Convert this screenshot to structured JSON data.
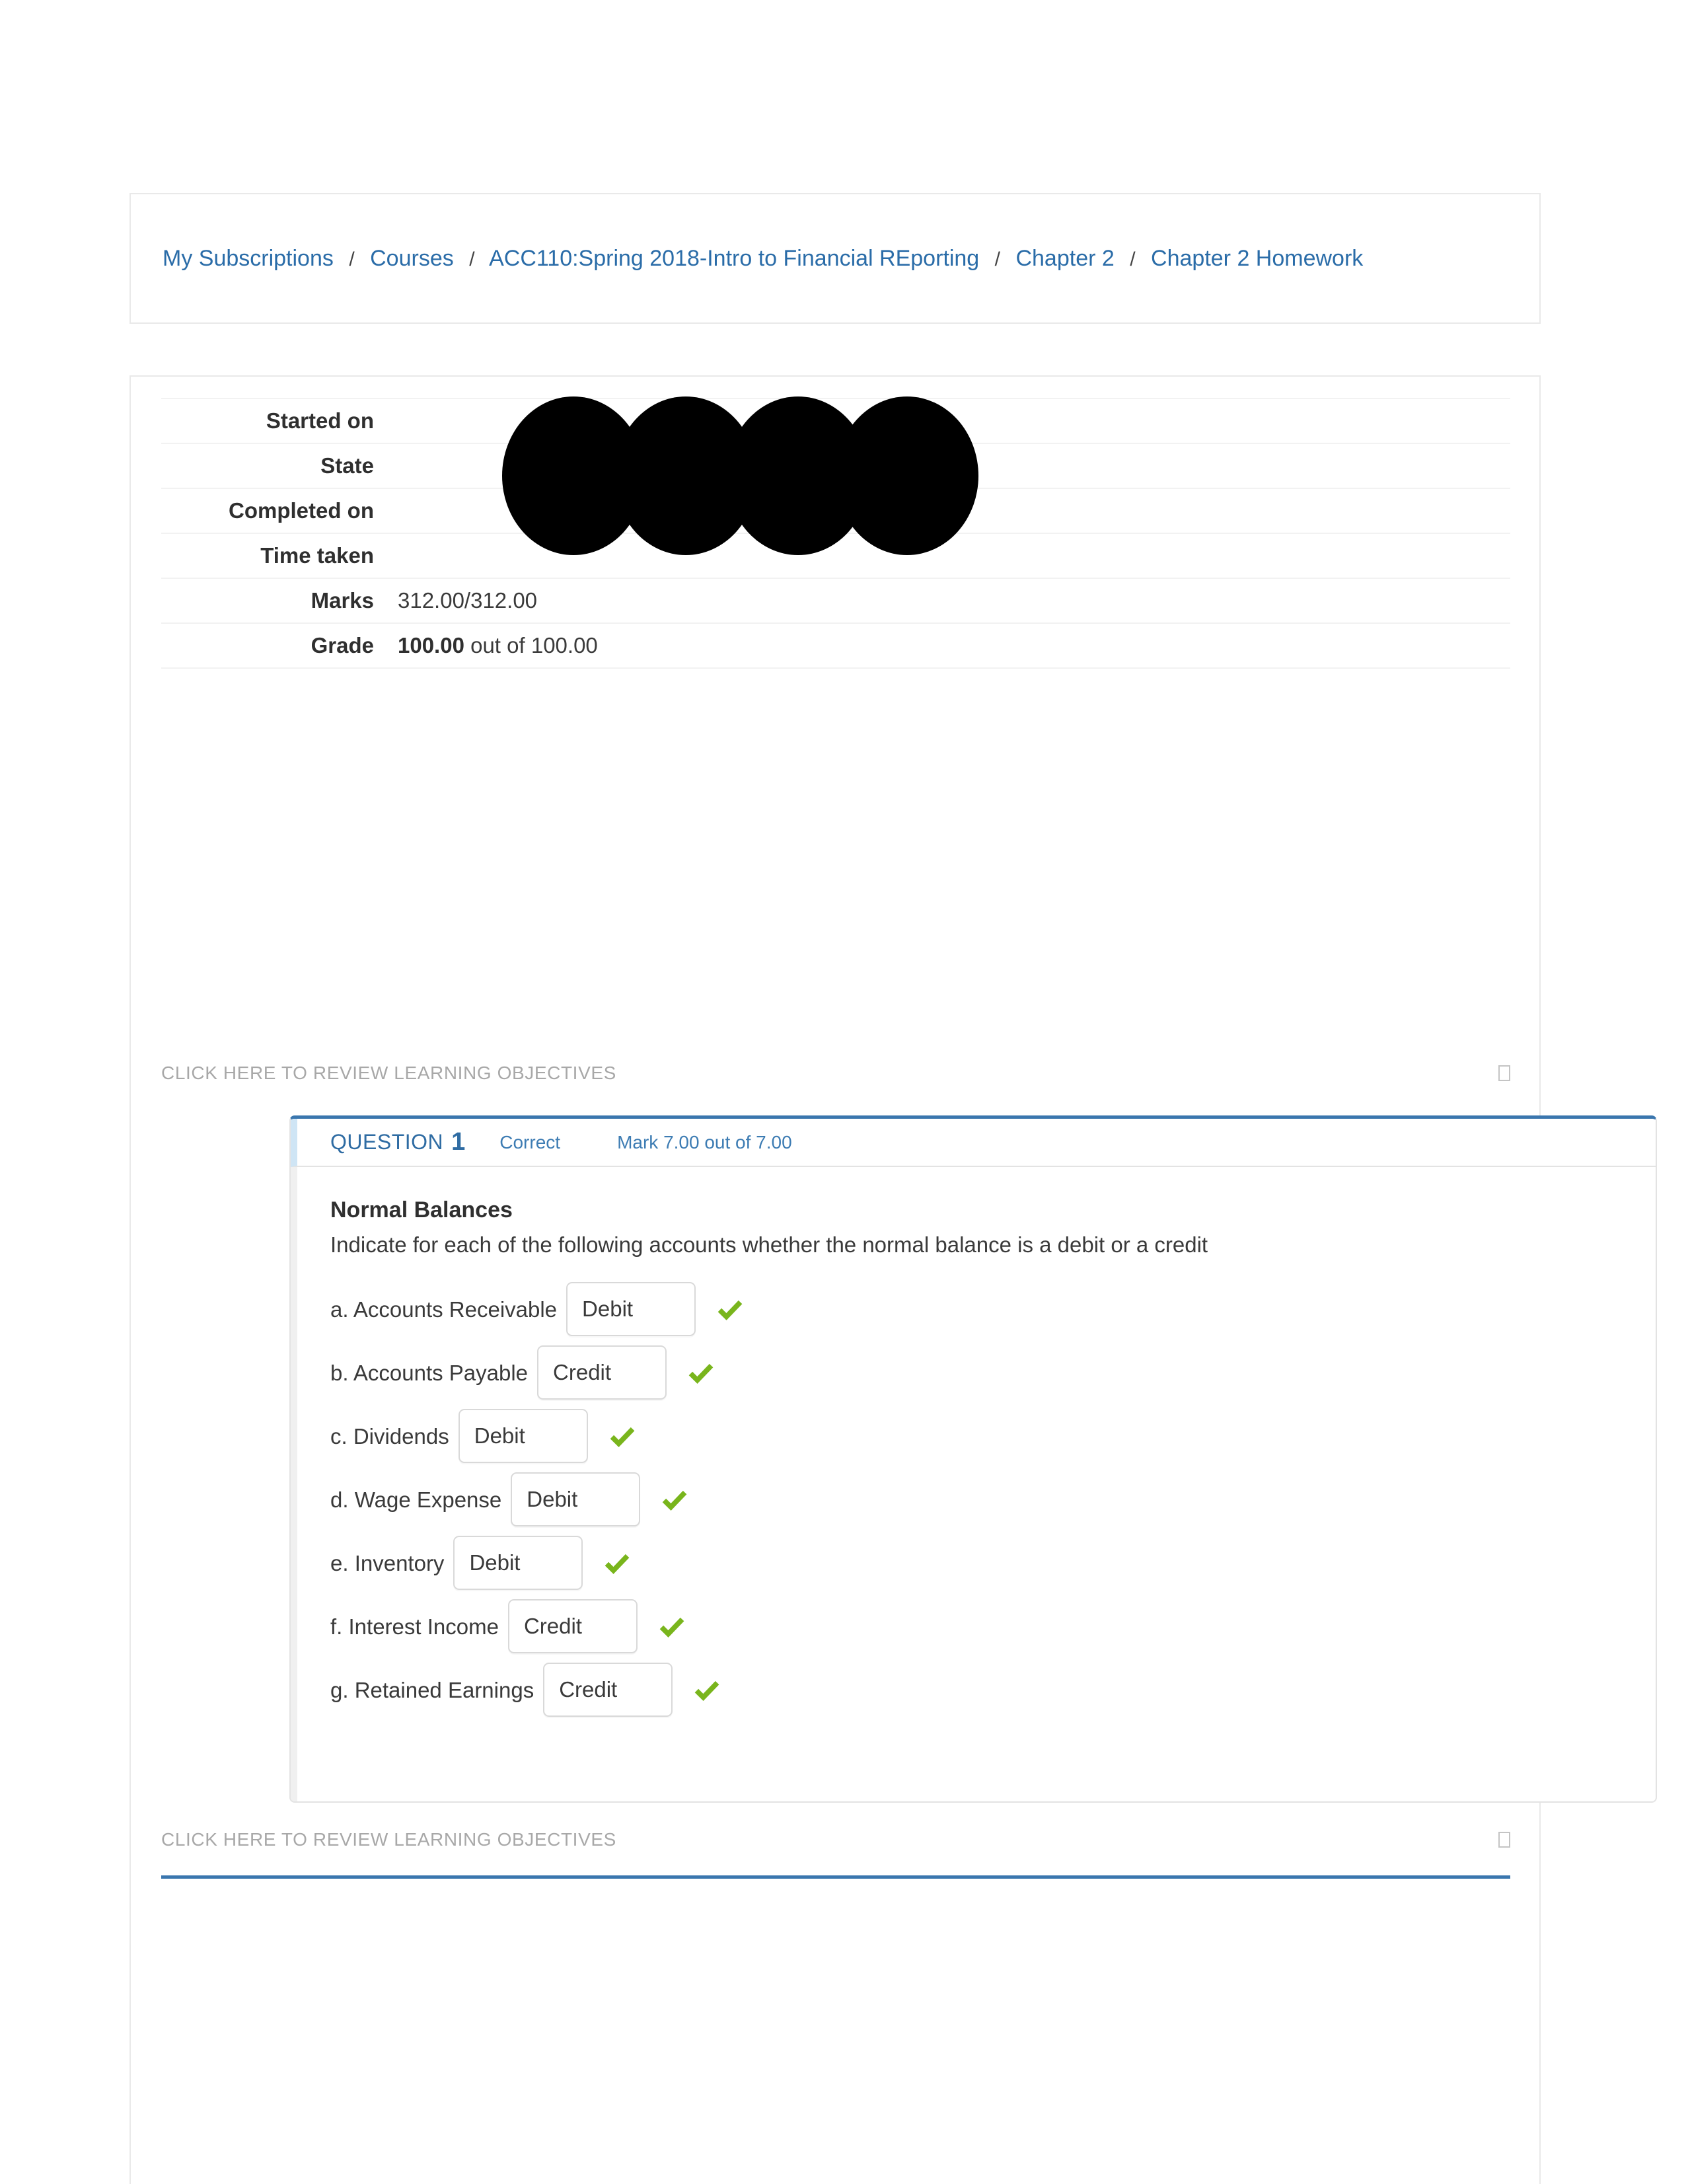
{
  "breadcrumb": {
    "separator": "/",
    "items": [
      {
        "label": "My Subscriptions"
      },
      {
        "label": "Courses"
      },
      {
        "label": "ACC110:Spring 2018-Intro to Financial REporting"
      },
      {
        "label": "Chapter 2"
      },
      {
        "label": "Chapter 2 Homework"
      }
    ]
  },
  "summary": {
    "rows": [
      {
        "label": "Started on",
        "value": "",
        "bold_value": "",
        "redacted": true
      },
      {
        "label": "State",
        "value": "",
        "bold_value": "",
        "redacted": true
      },
      {
        "label": "Completed on",
        "value": "",
        "bold_value": "",
        "redacted": true
      },
      {
        "label": "Time taken",
        "value": "",
        "bold_value": "",
        "redacted": true
      },
      {
        "label": "Marks",
        "value": "312.00/312.00",
        "bold_value": "",
        "redacted": false
      },
      {
        "label": "Grade",
        "value": " out of 100.00",
        "bold_value": "100.00",
        "redacted": false
      }
    ]
  },
  "learning_objectives": {
    "top_label": "CLICK HERE TO REVIEW LEARNING OBJECTIVES",
    "bottom_label": "CLICK HERE TO REVIEW LEARNING OBJECTIVES",
    "toggle_icon": "empty-box-icon"
  },
  "question": {
    "label": "QUESTION",
    "number": "1",
    "state": "Correct",
    "mark": "Mark 7.00 out of 7.00",
    "title": "Normal Balances",
    "prompt": "Indicate for each of the following accounts whether the normal balance is a debit or a credit",
    "answers": [
      {
        "label": "a. Accounts Receivable",
        "value": "Debit",
        "result_icon": "check-icon"
      },
      {
        "label": "b. Accounts Payable",
        "value": "Credit",
        "result_icon": "check-icon"
      },
      {
        "label": "c. Dividends",
        "value": "Debit",
        "result_icon": "check-icon"
      },
      {
        "label": "d. Wage Expense",
        "value": "Debit",
        "result_icon": "check-icon"
      },
      {
        "label": "e. Inventory",
        "value": "Debit",
        "result_icon": "check-icon"
      },
      {
        "label": "f. Interest Income",
        "value": "Credit",
        "result_icon": "check-icon"
      },
      {
        "label": "g. Retained Earnings",
        "value": "Credit",
        "result_icon": "check-icon"
      }
    ]
  },
  "colors": {
    "link_blue": "#2a6ca8",
    "accent_blue": "#3a76ae",
    "question_blue": "#2f6ca3",
    "check_green": "#79b51c",
    "border_gray": "#e9e9e9",
    "muted_gray": "#a8a8a8"
  }
}
